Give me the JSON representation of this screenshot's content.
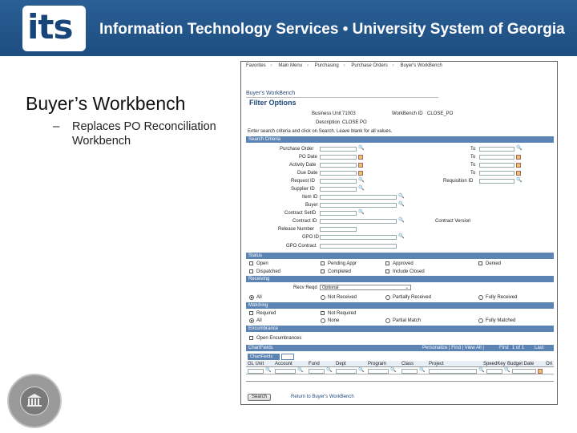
{
  "banner": {
    "logo_text": "its",
    "title": "Information Technology Services  •  University System of Georgia"
  },
  "slide": {
    "title": "Buyer’s Workbench",
    "bullet_dash": "–",
    "bullet": "Replaces PO Reconciliation Workbench"
  },
  "screenshot": {
    "breadcrumbs": [
      "Favorites",
      "Main Menu",
      "Purchasing",
      "Purchase Orders",
      "Buyer's WorkBench"
    ],
    "page_name": "Buyer's WorkBench",
    "heading": "Filter Options",
    "business_unit_label": "Business Unit",
    "business_unit_value": "71003",
    "workbench_id_label": "WorkBench ID",
    "workbench_id_value": "CLOSE_PO",
    "description_label": "Description",
    "description_value": "CLOSE PO",
    "instructions": "Enter search criteria and click on Search. Leave blank for all values.",
    "search_criteria_bar": "Search Criteria",
    "criteria_left": [
      "Purchase Order",
      "PO Date",
      "Activity Date",
      "Due Date",
      "Request ID",
      "Supplier ID",
      "Item ID",
      "Buyer",
      "Contract SetID",
      "Contract ID",
      "Release Number",
      "GPO ID",
      "GPO Contract"
    ],
    "to_label": "To",
    "requisition_id_label": "Requisition ID",
    "contract_version_label": "Contract Version",
    "status_bar": "Status",
    "status_options": [
      "Open",
      "Pending Appr",
      "Approved",
      "Denied",
      "Dispatched",
      "Completed",
      "Include Closed"
    ],
    "receiving_bar": "Receiving",
    "receipt_required_label": "Recv Reqd",
    "receipt_required_value": "Optional",
    "receiving_options": [
      "All",
      "Not Received",
      "Partially Received",
      "Fully Received"
    ],
    "matching_bar": "Matching",
    "matching_checks": [
      "Required",
      "Not Required"
    ],
    "matching_options": [
      "All",
      "None",
      "Partial Match",
      "Fully Matched"
    ],
    "encumbrance_bar": "Encumbrance",
    "encumbrance_option": "Open Encumbrances",
    "chartfields_bar": "ChartFields",
    "chartfields_nav": "Personalize | Find | View All |",
    "chartfields_first": "First",
    "chartfields_range": "1 of 1",
    "chartfields_last": "Last",
    "chartfields_tab": "ChartFields",
    "grid_columns": [
      "GL Unit",
      "Account",
      "Fund",
      "Dept",
      "Program",
      "Class",
      "Project",
      "SpeedKey",
      "Budget Date",
      "Ori"
    ],
    "search_button": "Search",
    "return_link": "Return to Buyer's WorkBench"
  }
}
